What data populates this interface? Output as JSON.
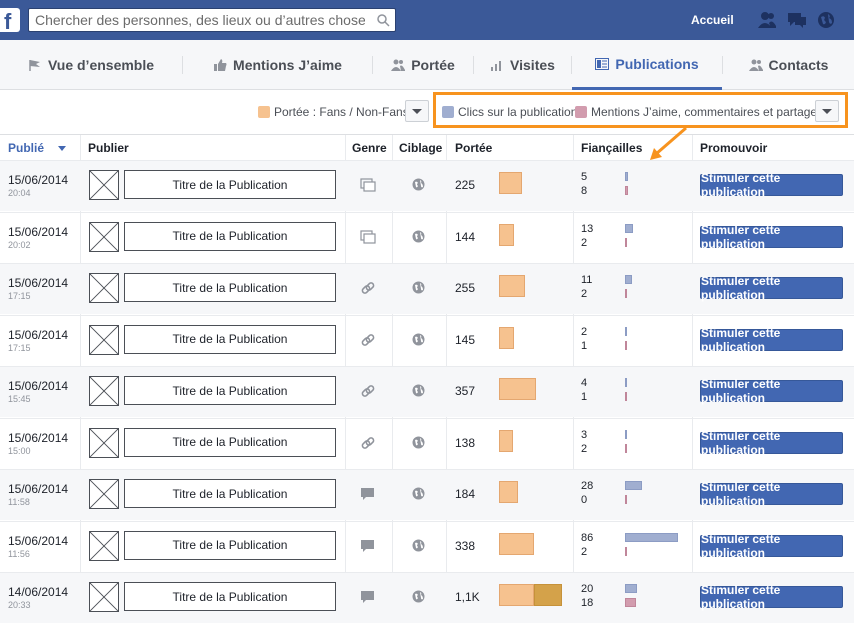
{
  "topbar": {
    "logo": "f",
    "search_placeholder": "Chercher des personnes, des lieux ou d’autres choses",
    "home": "Accueil",
    "icons": [
      "friends-icon",
      "messages-icon",
      "notifications-globe-icon"
    ]
  },
  "tabs": [
    {
      "label": "Vue d’ensemble",
      "icon": "flag-icon"
    },
    {
      "label": "Mentions J’aime",
      "icon": "thumbs-up-icon"
    },
    {
      "label": "Portée",
      "icon": "people-icon"
    },
    {
      "label": "Visites",
      "icon": "bar-chart-icon"
    },
    {
      "label": "Publications",
      "icon": "list-icon",
      "active": true
    },
    {
      "label": "Contacts",
      "icon": "people-icon"
    }
  ],
  "filters": {
    "reach_legend": "Portée : Fans / Non-Fans",
    "clicks_legend": "Clics sur la publication",
    "likes_legend": "Mentions J’aime, commentaires et partages",
    "colors": {
      "reach": "#f6c28f",
      "clicks": "#a0aed0",
      "likes": "#d29cae",
      "highlight": "#f7931e"
    }
  },
  "table": {
    "headers": {
      "published": "Publié",
      "post": "Publier",
      "genre": "Genre",
      "targeting": "Ciblage",
      "reach": "Portée",
      "engagement": "Fiançailles",
      "promote": "Promouvoir"
    },
    "rows": [
      {
        "date": "15/06/2014",
        "time": "20:04",
        "title": "Titre de la Publication",
        "genre": "album",
        "reach": "225",
        "reach_level": 0.37,
        "reach_level2": 0,
        "clicks": "5",
        "likes": "8",
        "clicks_level": 0.05,
        "likes_level": 0.06,
        "boost": "Stimuler cette publication"
      },
      {
        "date": "15/06/2014",
        "time": "20:02",
        "title": "Titre de la Publication",
        "genre": "album",
        "reach": "144",
        "reach_level": 0.24,
        "reach_level2": 0,
        "clicks": "13",
        "likes": "2",
        "clicks_level": 0.14,
        "likes_level": 0.02,
        "boost": "Stimuler cette publication"
      },
      {
        "date": "15/06/2014",
        "time": "17:15",
        "title": "Titre de la Publication",
        "genre": "link",
        "reach": "255",
        "reach_level": 0.42,
        "reach_level2": 0,
        "clicks": "11",
        "likes": "2",
        "clicks_level": 0.12,
        "likes_level": 0.02,
        "boost": "Stimuler cette publication"
      },
      {
        "date": "15/06/2014",
        "time": "17:15",
        "title": "Titre de la Publication",
        "genre": "link",
        "reach": "145",
        "reach_level": 0.24,
        "reach_level2": 0,
        "clicks": "2",
        "likes": "1",
        "clicks_level": 0.02,
        "likes_level": 0.01,
        "boost": "Stimuler cette publication"
      },
      {
        "date": "15/06/2014",
        "time": "15:45",
        "title": "Titre de la Publication",
        "genre": "link",
        "reach": "357",
        "reach_level": 0.59,
        "reach_level2": 0,
        "clicks": "4",
        "likes": "1",
        "clicks_level": 0.04,
        "likes_level": 0.01,
        "boost": "Stimuler cette publication"
      },
      {
        "date": "15/06/2014",
        "time": "15:00",
        "title": "Titre de la Publication",
        "genre": "link",
        "reach": "138",
        "reach_level": 0.23,
        "reach_level2": 0,
        "clicks": "3",
        "likes": "2",
        "clicks_level": 0.03,
        "likes_level": 0.02,
        "boost": "Stimuler cette publication"
      },
      {
        "date": "15/06/2014",
        "time": "11:58",
        "title": "Titre de la Publication",
        "genre": "status",
        "reach": "184",
        "reach_level": 0.3,
        "reach_level2": 0,
        "clicks": "28",
        "likes": "0",
        "clicks_level": 0.31,
        "likes_level": 0,
        "boost": "Stimuler cette publication"
      },
      {
        "date": "15/06/2014",
        "time": "11:56",
        "title": "Titre de la Publication",
        "genre": "status",
        "reach": "338",
        "reach_level": 0.56,
        "reach_level2": 0,
        "clicks": "86",
        "likes": "2",
        "clicks_level": 0.96,
        "likes_level": 0.02,
        "boost": "Stimuler cette publication"
      },
      {
        "date": "14/06/2014",
        "time": "20:33",
        "title": "Titre de la Publication",
        "genre": "status",
        "reach": "1,1K",
        "reach_level": 0.56,
        "reach_level2": 0.44,
        "clicks": "20",
        "likes": "18",
        "clicks_level": 0.22,
        "likes_level": 0.2,
        "boost": "Stimuler cette publication"
      }
    ]
  }
}
